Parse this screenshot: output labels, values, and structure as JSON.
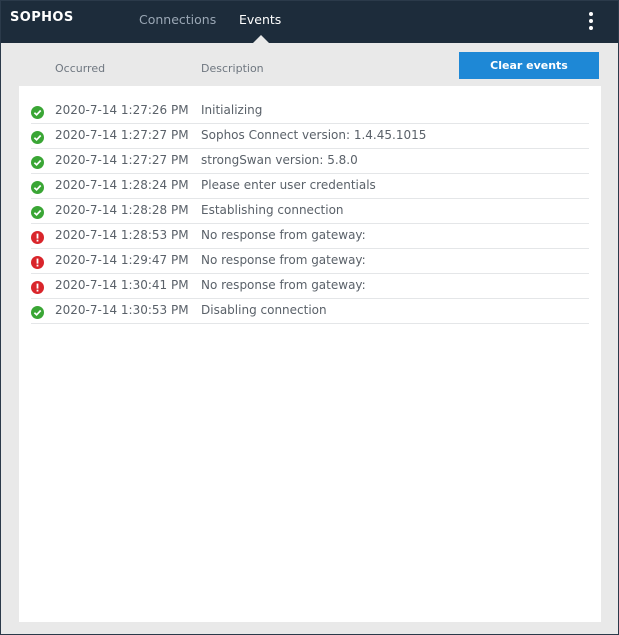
{
  "app": {
    "logo": "SOPHOS"
  },
  "nav": {
    "tabs": [
      {
        "label": "Connections",
        "active": false
      },
      {
        "label": "Events",
        "active": true
      }
    ],
    "menu_icon": "vertical-ellipsis-icon"
  },
  "events": {
    "columns": {
      "occurred": "Occurred",
      "description": "Description"
    },
    "clear_button_label": "Clear events",
    "rows": [
      {
        "status": "success",
        "icon": "check-circle-icon",
        "occurred": "2020-7-14 1:27:26 PM",
        "description": "Initializing"
      },
      {
        "status": "success",
        "icon": "check-circle-icon",
        "occurred": "2020-7-14 1:27:27 PM",
        "description": "Sophos Connect version: 1.4.45.1015"
      },
      {
        "status": "success",
        "icon": "check-circle-icon",
        "occurred": "2020-7-14 1:27:27 PM",
        "description": "strongSwan version: 5.8.0"
      },
      {
        "status": "success",
        "icon": "check-circle-icon",
        "occurred": "2020-7-14 1:28:24 PM",
        "description": "Please enter user credentials"
      },
      {
        "status": "success",
        "icon": "check-circle-icon",
        "occurred": "2020-7-14 1:28:28 PM",
        "description": "Establishing connection"
      },
      {
        "status": "error",
        "icon": "error-circle-icon",
        "occurred": "2020-7-14 1:28:53 PM",
        "description": "No response from gateway:"
      },
      {
        "status": "error",
        "icon": "error-circle-icon",
        "occurred": "2020-7-14 1:29:47 PM",
        "description": "No response from gateway:"
      },
      {
        "status": "error",
        "icon": "error-circle-icon",
        "occurred": "2020-7-14 1:30:41 PM",
        "description": "No response from gateway:"
      },
      {
        "status": "success",
        "icon": "check-circle-icon",
        "occurred": "2020-7-14 1:30:53 PM",
        "description": "Disabling connection"
      }
    ]
  },
  "colors": {
    "topbar": "#1d2c3b",
    "accent": "#1e88d6",
    "success": "#3aa635",
    "error": "#d9252b",
    "background": "#e9e9e9"
  }
}
